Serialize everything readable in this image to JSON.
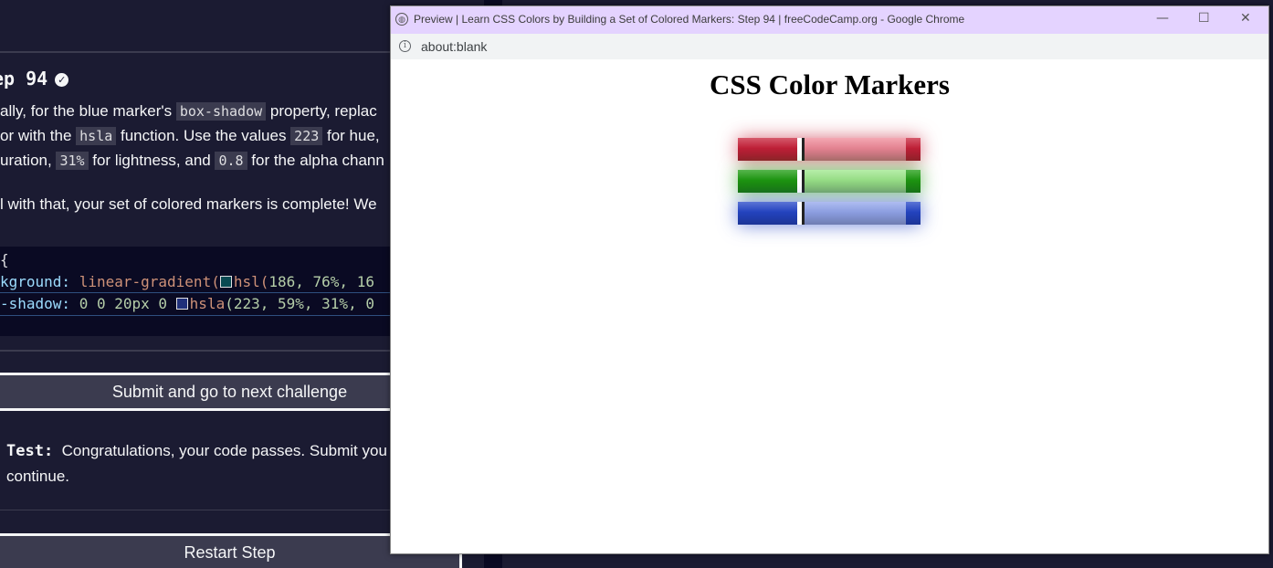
{
  "left_panel": {
    "step_title": "ep 94",
    "desc_line1": [
      "ally, for the blue marker's ",
      "box-shadow",
      " property, replac"
    ],
    "desc_line2": [
      "or with the ",
      "hsla",
      " function. Use the values ",
      "223",
      " for hue,"
    ],
    "desc_line3": [
      "uration, ",
      "31%",
      " for lightness, and ",
      "0.8",
      " for the alpha chann"
    ],
    "desc_line4": "l with that, your set of colored markers is complete! We",
    "code": {
      "line1": " {",
      "line2_prop": "kground:",
      "line2_fn": "linear-gradient(",
      "line2_hsl": "hsl(",
      "line2_vals": "186, 76%, 16",
      "line3_prop": "-shadow:",
      "line3_vals1": "0 0 20px 0",
      "line3_fn": "hsla",
      "line3_vals2": "(223, 59%, 31%, 0"
    },
    "submit_button": "Submit and go to next challenge",
    "test_label": "Test:",
    "test_text": "Congratulations, your code passes. Submit you",
    "test_text2": "continue.",
    "restart_button": "Restart Step"
  },
  "preview_window": {
    "title": "Preview | Learn CSS Colors by Building a Set of Colored Markers: Step 94 | freeCodeCamp.org - Google Chrome",
    "url": "about:blank",
    "page_heading": "CSS Color Markers",
    "markers": [
      {
        "name": "red",
        "cap": "#c8223a",
        "sleeve": "#f08a99",
        "glow": "#c8223a"
      },
      {
        "name": "green",
        "cap": "#1f9c12",
        "sleeve": "#9ee88c",
        "glow": "#1f9c12"
      },
      {
        "name": "blue",
        "cap": "#2546c8",
        "sleeve": "#93a6ec",
        "glow": "#2546c8"
      }
    ]
  }
}
